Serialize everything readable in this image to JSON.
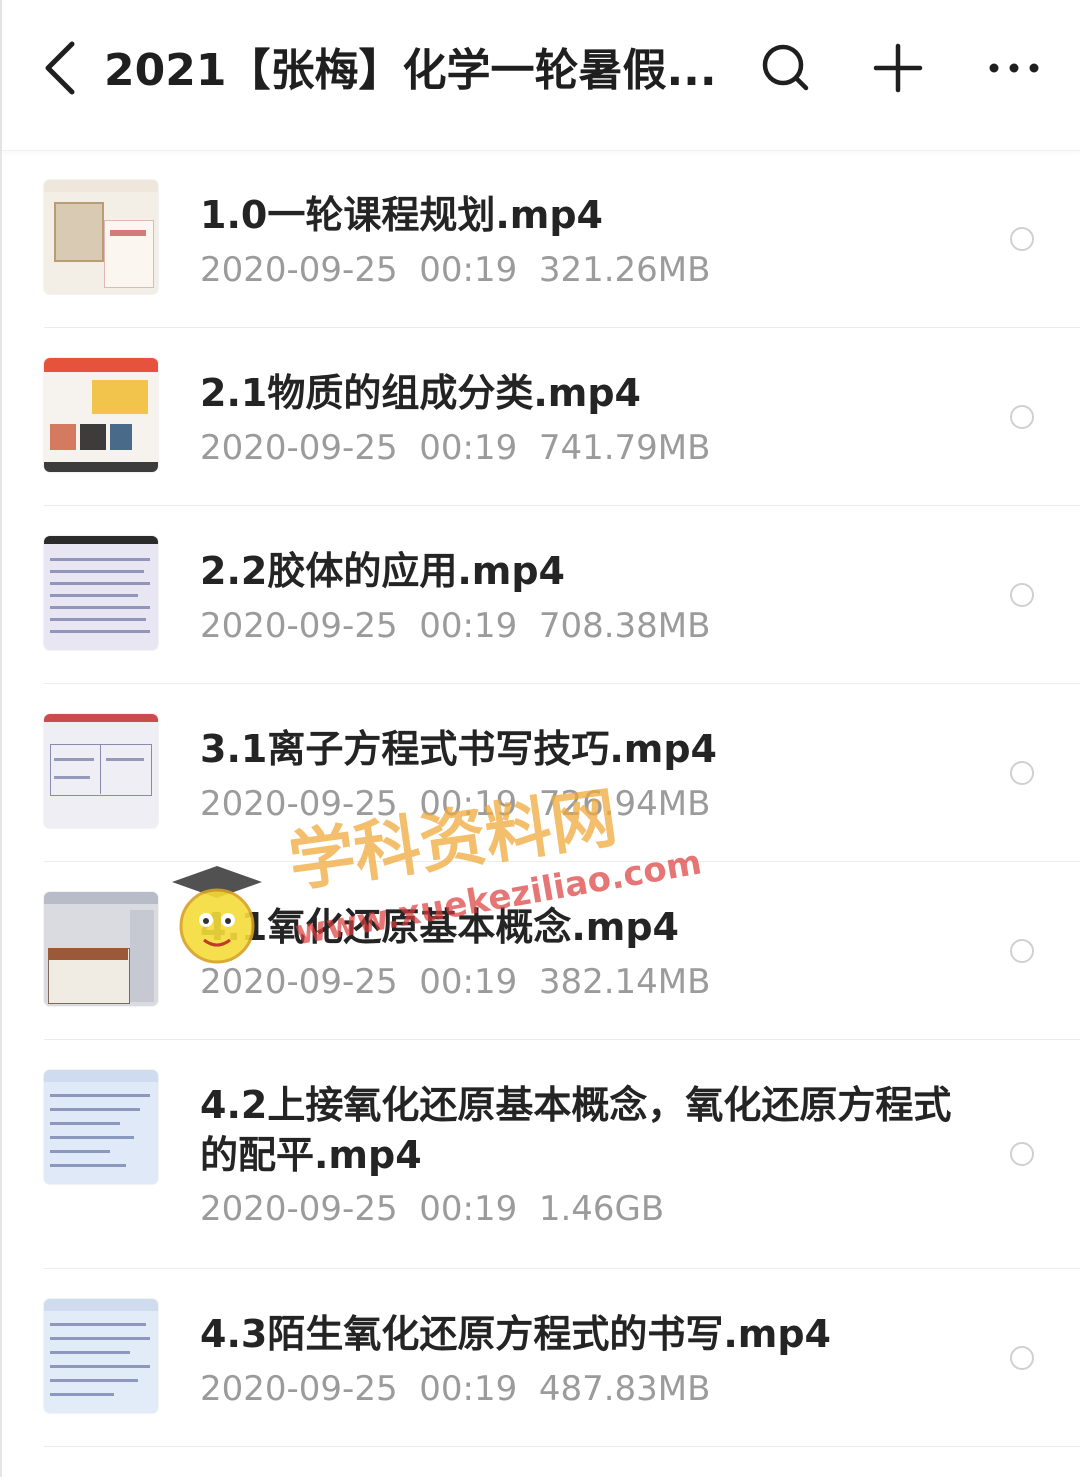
{
  "header": {
    "title": "2021【张梅】化学一轮暑假..."
  },
  "files": [
    {
      "name": "1.0一轮课程规划.mp4",
      "date": "2020-09-25",
      "time": "00:19",
      "size": "321.26MB",
      "thumb": "certificate"
    },
    {
      "name": "2.1物质的组成分类.mp4",
      "date": "2020-09-25",
      "time": "00:19",
      "size": "741.79MB",
      "thumb": "slides"
    },
    {
      "name": "2.2胶体的应用.mp4",
      "date": "2020-09-25",
      "time": "00:19",
      "size": "708.38MB",
      "thumb": "document"
    },
    {
      "name": "3.1离子方程式书写技巧.mp4",
      "date": "2020-09-25",
      "time": "00:19",
      "size": "726.94MB",
      "thumb": "table"
    },
    {
      "name": "4.1氧化还原基本概念.mp4",
      "date": "2020-09-25",
      "time": "00:19",
      "size": "382.14MB",
      "thumb": "nutrition-label"
    },
    {
      "name": "4.2上接氧化还原基本概念，氧化还原方程式的配平.mp4",
      "date": "2020-09-25",
      "time": "00:19",
      "size": "1.46GB",
      "thumb": "notes"
    },
    {
      "name": "4.3陌生氧化还原方程式的书写.mp4",
      "date": "2020-09-25",
      "time": "00:19",
      "size": "487.83MB",
      "thumb": "notes"
    }
  ],
  "watermark": {
    "title": "学科资料网",
    "url": "www.xuekeziliao.com"
  },
  "icons": {
    "back": "back-chevron-icon",
    "search": "search-icon",
    "add": "plus-icon",
    "more": "more-dots-icon",
    "select": "radio-circle-icon"
  },
  "colors": {
    "title": "#1f1f1f",
    "file_name": "#242424",
    "meta": "#9b9b9b",
    "divider": "#ececec"
  }
}
